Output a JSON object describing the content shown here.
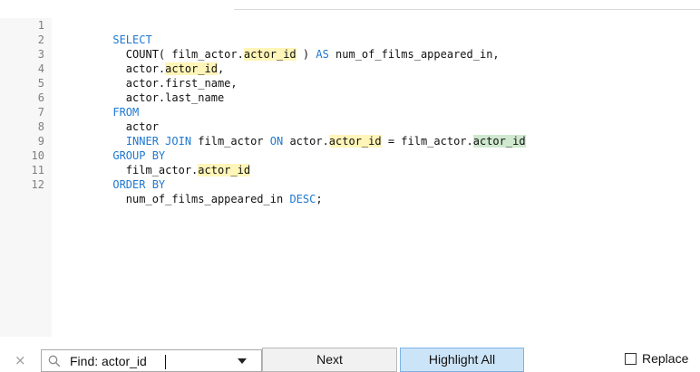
{
  "editor": {
    "lines": [
      {
        "number": "1",
        "tokens": [
          {
            "text": "SELECT",
            "kind": "kw"
          }
        ]
      },
      {
        "number": "2",
        "tokens": [
          {
            "text": "  COUNT( film_actor.",
            "kind": "txt"
          },
          {
            "text": "actor_id",
            "kind": "hl"
          },
          {
            "text": " ) ",
            "kind": "txt"
          },
          {
            "text": "AS",
            "kind": "kw"
          },
          {
            "text": " num_of_films_appeared_in,",
            "kind": "txt"
          }
        ]
      },
      {
        "number": "3",
        "tokens": [
          {
            "text": "  actor.",
            "kind": "txt"
          },
          {
            "text": "actor_id",
            "kind": "hl"
          },
          {
            "text": ",",
            "kind": "txt"
          }
        ]
      },
      {
        "number": "4",
        "tokens": [
          {
            "text": "  actor.first_name,",
            "kind": "txt"
          }
        ]
      },
      {
        "number": "5",
        "tokens": [
          {
            "text": "  actor.last_name",
            "kind": "txt"
          }
        ]
      },
      {
        "number": "6",
        "tokens": [
          {
            "text": "FROM",
            "kind": "kw"
          }
        ]
      },
      {
        "number": "7",
        "tokens": [
          {
            "text": "  actor",
            "kind": "txt"
          }
        ]
      },
      {
        "number": "8",
        "tokens": [
          {
            "text": "  ",
            "kind": "txt"
          },
          {
            "text": "INNER JOIN",
            "kind": "kw"
          },
          {
            "text": " film_actor ",
            "kind": "txt"
          },
          {
            "text": "ON",
            "kind": "kw"
          },
          {
            "text": " actor.",
            "kind": "txt"
          },
          {
            "text": "actor_id",
            "kind": "hl"
          },
          {
            "text": " = film_actor.",
            "kind": "txt"
          },
          {
            "text": "actor_id",
            "kind": "hl-current"
          }
        ]
      },
      {
        "number": "9",
        "tokens": [
          {
            "text": "GROUP BY",
            "kind": "kw"
          }
        ]
      },
      {
        "number": "10",
        "tokens": [
          {
            "text": "  film_actor.",
            "kind": "txt"
          },
          {
            "text": "actor_id",
            "kind": "hl"
          }
        ]
      },
      {
        "number": "11",
        "tokens": [
          {
            "text": "ORDER BY",
            "kind": "kw"
          }
        ]
      },
      {
        "number": "12",
        "tokens": [
          {
            "text": "  num_of_films_appeared_in ",
            "kind": "txt"
          },
          {
            "text": "DESC",
            "kind": "kw"
          },
          {
            "text": ";",
            "kind": "txt"
          }
        ]
      }
    ]
  },
  "find_bar": {
    "close_icon": "close-icon",
    "search_icon": "search-icon",
    "dropdown_icon": "chevron-down-icon",
    "input_value": "Find: actor_id",
    "next_label": "Next",
    "highlight_all_label": "Highlight All",
    "replace_label": "Replace",
    "replace_checked": false
  },
  "colors": {
    "keyword": "#1f78d1",
    "highlight": "#fff5b8",
    "current_match": "#cfe8cf",
    "selected_button": "#cce4f7"
  }
}
